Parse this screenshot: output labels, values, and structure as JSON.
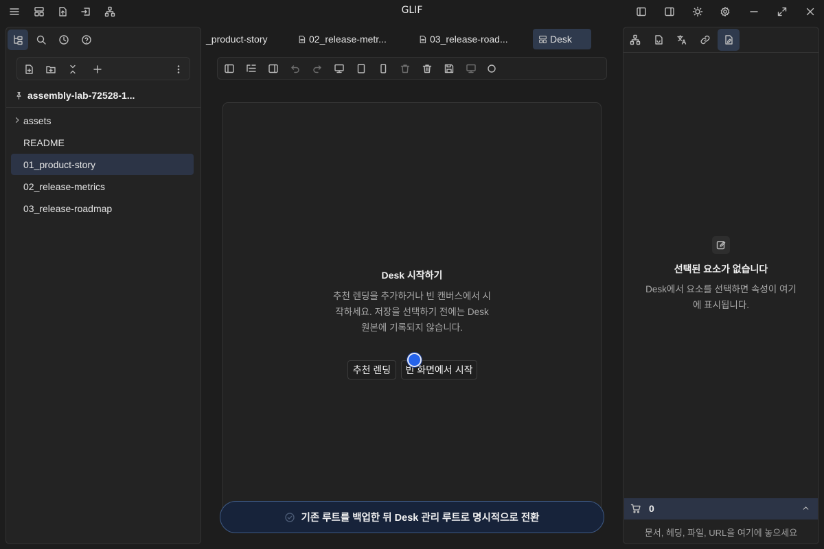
{
  "app": {
    "title": "GLIF"
  },
  "titlebar": {
    "left_icons": [
      "menu-icon",
      "layout-icon",
      "export-icon",
      "import-icon",
      "hierarchy-icon"
    ],
    "right_icons": [
      "toggle-left-sidebar-icon",
      "toggle-right-sidebar-icon",
      "theme-icon",
      "settings-icon",
      "minimize-icon",
      "maximize-icon",
      "close-icon"
    ]
  },
  "left_panel": {
    "tabs": [
      "file-tree-icon",
      "search-icon",
      "history-icon",
      "help-icon"
    ],
    "toolbar": [
      "new-file-icon",
      "new-folder-icon",
      "collapse-all-icon",
      "add-icon",
      "more-icon"
    ],
    "vault_name": "assembly-lab-72528-1...",
    "tree": [
      {
        "label": "assets",
        "type": "folder"
      },
      {
        "label": "README",
        "type": "file"
      },
      {
        "label": "01_product-story",
        "type": "file",
        "selected": true
      },
      {
        "label": "02_release-metrics",
        "type": "file"
      },
      {
        "label": "03_release-roadmap",
        "type": "file"
      }
    ]
  },
  "tabs": [
    {
      "label": "_product-story"
    },
    {
      "label": "02_release-metr..."
    },
    {
      "label": "03_release-road..."
    },
    {
      "label": "Desk",
      "active": true
    }
  ],
  "editor_toolbar": [
    "panel-icon",
    "outline-icon",
    "split-icon",
    "undo-icon",
    "redo-icon",
    "desktop-icon",
    "tablet-icon",
    "mobile-icon",
    "delete-icon",
    "trash-icon",
    "save-icon",
    "preview-icon",
    "circle-icon"
  ],
  "canvas": {
    "title": "Desk 시작하기",
    "description_lines": [
      "추천 렌딩을 추가하거나 빈 캔버스에서 시",
      "작하세요. 저장을 선택하기 전에는 Desk",
      "원본에 기록되지 않습니다."
    ],
    "buttons": {
      "recommended": "추천 렌딩",
      "blank": "빈 화면에서 시작"
    }
  },
  "toast": {
    "text": "기존 루트를 백업한 뒤 Desk 관리 루트로 명시적으로 전환"
  },
  "right_panel": {
    "tabs": [
      "structure-icon",
      "document-icon",
      "translate-icon",
      "link-icon",
      "inspector-icon"
    ],
    "empty_title": "선택된 요소가 없습니다",
    "empty_desc_lines": [
      "Desk에서 요소를 선택하면 속성이 여기",
      "에 표시됩니다."
    ],
    "cart_count": "0",
    "drop_hint": "문서, 헤딩, 파일, URL을 여기에 놓으세요"
  },
  "colors": {
    "accent": "#2563eb",
    "selection": "#2c3446",
    "toast_bg": "#17233a"
  }
}
